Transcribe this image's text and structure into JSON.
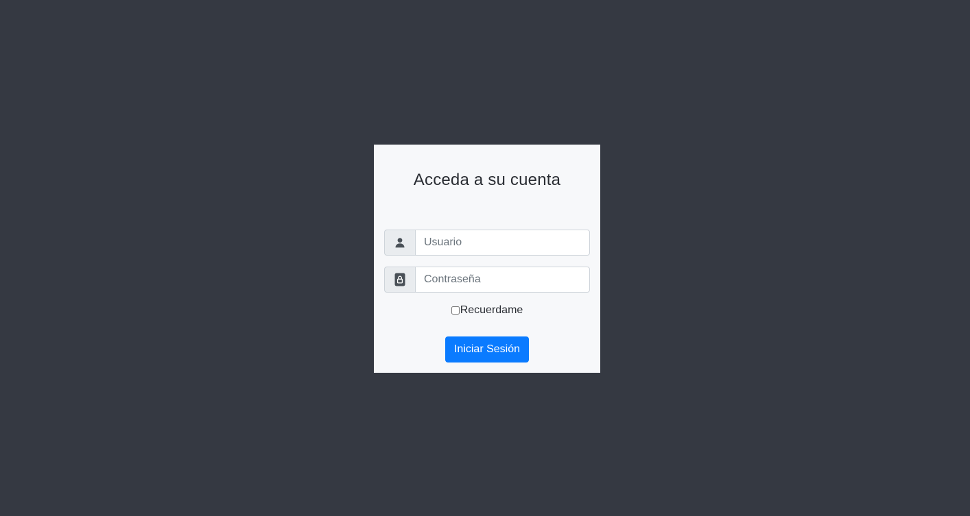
{
  "login": {
    "title": "Acceda a su cuenta",
    "username": {
      "icon": "user-icon",
      "value": "",
      "placeholder": "Usuario"
    },
    "password": {
      "icon": "lock-icon",
      "value": "",
      "placeholder": "Contraseña"
    },
    "remember_label": "Recuerdame",
    "remember_checked": false,
    "submit_label": "Iniciar Sesión"
  },
  "colors": {
    "background": "#353942",
    "card": "#f7f8fa",
    "primary": "#0a7bff",
    "icon": "#495057"
  }
}
